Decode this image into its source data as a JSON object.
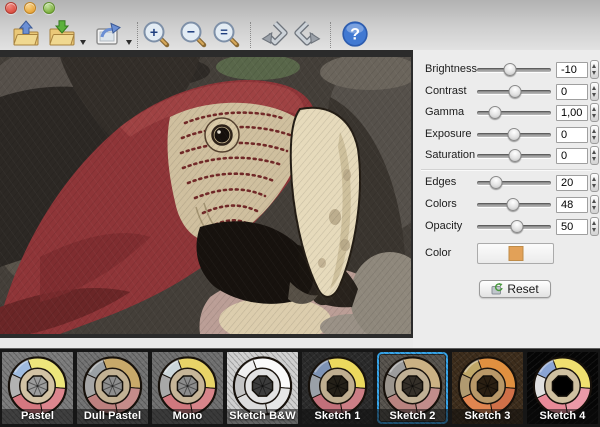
{
  "window": {
    "traffic_lights": [
      {
        "name": "close",
        "color": "#dd5144"
      },
      {
        "name": "minimize",
        "color": "#e9a83c"
      },
      {
        "name": "zoom",
        "color": "#7fb13f"
      }
    ]
  },
  "toolbar": {
    "buttons": [
      {
        "id": "open",
        "icon": "folder-open-up-icon",
        "has_dropdown": false
      },
      {
        "id": "save",
        "icon": "folder-save-down-icon",
        "has_dropdown": true
      },
      {
        "id": "export",
        "icon": "export-image-icon",
        "has_dropdown": true
      },
      {
        "id": "zoom-in",
        "icon": "magnifier-plus-icon",
        "glyph": "+"
      },
      {
        "id": "zoom-out",
        "icon": "magnifier-minus-icon",
        "glyph": "−"
      },
      {
        "id": "zoom-actual",
        "icon": "magnifier-equal-icon",
        "glyph": "="
      },
      {
        "id": "undo",
        "icon": "undo-arrow-icon"
      },
      {
        "id": "redo",
        "icon": "redo-arrow-icon"
      },
      {
        "id": "help",
        "icon": "question-mark-icon",
        "glyph": "?"
      }
    ]
  },
  "panel": {
    "adjustments": [
      {
        "label": "Brightness",
        "value": "-10",
        "pct": 45
      },
      {
        "label": "Contrast",
        "value": "0",
        "pct": 52
      },
      {
        "label": "Gamma",
        "value": "1,00",
        "pct": 24
      },
      {
        "label": "Exposure",
        "value": "0",
        "pct": 50
      },
      {
        "label": "Saturation",
        "value": "0",
        "pct": 52
      }
    ],
    "effect": [
      {
        "label": "Edges",
        "value": "20",
        "pct": 25
      },
      {
        "label": "Colors",
        "value": "48",
        "pct": 48
      },
      {
        "label": "Opacity",
        "value": "50",
        "pct": 54
      }
    ],
    "color_label": "Color",
    "color_swatch": "#e2a158",
    "reset_label": "Reset"
  },
  "presets": {
    "selected_border": "#35a3e8",
    "items": [
      {
        "label": "Pastel",
        "selected": false,
        "palette": {
          "bg": "#7b7b7b",
          "blue": "#9fbbdf",
          "yellow": "#eee67c",
          "pink": "#dd868e",
          "pink2": "#d57880",
          "grey": "#b2b2b2",
          "mid": "#d2c2a4",
          "inner": "#9c9c9c"
        }
      },
      {
        "label": "Dull Pastel",
        "selected": false,
        "palette": {
          "bg": "#717171",
          "blue": "#9aa0a4",
          "yellow": "#c8a96a",
          "pink": "#c58c8a",
          "pink2": "#bd807e",
          "grey": "#a5a5a5",
          "mid": "#c2b193",
          "inner": "#8e8e8e"
        }
      },
      {
        "label": "Mono",
        "selected": false,
        "palette": {
          "bg": "#6f6f6f",
          "blue": "#ccd6da",
          "yellow": "#e8d468",
          "pink": "#d8858a",
          "pink2": "#d0787e",
          "grey": "#a8a8a8",
          "mid": "#c6b598",
          "inner": "#8c8c8c"
        }
      },
      {
        "label": "Sketch B&W",
        "selected": false,
        "palette": {
          "bg": "#cfcfcf",
          "blue": "#efefef",
          "yellow": "#fafafa",
          "pink": "#e6e6e6",
          "pink2": "#dcdcdc",
          "grey": "#c4c4c4",
          "mid": "#e2e2e2",
          "inner": "#3c3c3c"
        }
      },
      {
        "label": "Sketch 1",
        "selected": false,
        "palette": {
          "bg": "#2b2b2b",
          "blue": "#7e93b5",
          "yellow": "#ecd95e",
          "pink": "#cc7e85",
          "pink2": "#c2707a",
          "grey": "#9aa0a8",
          "mid": "#bfae90",
          "inner": "#242018"
        }
      },
      {
        "label": "Sketch 2",
        "selected": true,
        "palette": {
          "bg": "#56524c",
          "blue": "#9c9c9c",
          "yellow": "#cbb184",
          "pink": "#c18d8b",
          "pink2": "#b8837f",
          "grey": "#9a948c",
          "mid": "#c0b094",
          "inner": "#353029"
        }
      },
      {
        "label": "Sketch 3",
        "selected": false,
        "palette": {
          "bg": "#3d2d1c",
          "blue": "#c0a868",
          "yellow": "#e09040",
          "pink": "#d07048",
          "pink2": "#e08550",
          "grey": "#b09a70",
          "mid": "#b89868",
          "inner": "#2a1f12"
        }
      },
      {
        "label": "Sketch 4",
        "selected": false,
        "palette": {
          "bg": "#060606",
          "blue": "#8aa4d4",
          "yellow": "#f0e070",
          "pink": "#eb9aa8",
          "pink2": "#e88a98",
          "grey": "#e0e0e0",
          "mid": "#cfc0a0",
          "inner": "#000000"
        }
      }
    ]
  }
}
